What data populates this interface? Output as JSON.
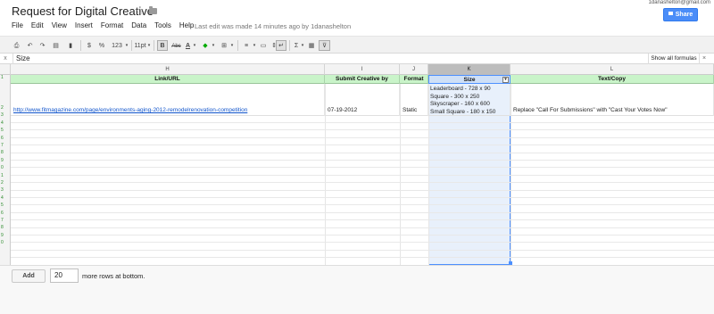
{
  "window": {
    "title": "Request for Digital Creative",
    "account_email": "1danashelton@gmail.com",
    "share_label": "Share"
  },
  "menu": [
    "File",
    "Edit",
    "View",
    "Insert",
    "Format",
    "Data",
    "Tools",
    "Help"
  ],
  "last_edit": "Last edit was made 14 minutes ago by 1danashelton",
  "toolbar": {
    "currency": "$",
    "percent": "%",
    "number_format": "123",
    "font_size": "11pt",
    "bold": "B",
    "strikethrough": "Abc",
    "text_color": "A",
    "sum": "Σ"
  },
  "formula_bar": {
    "fx": "x",
    "value": "Size",
    "show_all": "Show all formulas",
    "close": "×"
  },
  "columns": [
    "H",
    "I",
    "J",
    "K",
    "L"
  ],
  "selected_column": "K",
  "headers": [
    "Link/URL",
    "Submit Creative by",
    "Format",
    "Size",
    "Text/Copy"
  ],
  "row": {
    "link": "http://www.fitmagazine.com/page/environments-aging-2012-remodelrenovation-competition",
    "submit_by": "07-19-2012",
    "format": "Static",
    "sizes": [
      "Leaderboard - 728 x 90",
      "Square - 300 x 250",
      "Skyscraper - 160 x 600",
      "Small Square - 180 x 150"
    ],
    "text_copy": "Replace \"Call For Submissions\" with \"Cast Your Votes Now\""
  },
  "row_numbers": [
    "1",
    "2",
    "3",
    "4",
    "5",
    "6",
    "7",
    "8",
    "9",
    "0",
    "1",
    "2",
    "3",
    "4",
    "5",
    "6",
    "7",
    "8",
    "9",
    "0"
  ],
  "footer": {
    "add_label": "Add",
    "rows_value": "20",
    "rows_suffix": "more rows at bottom."
  }
}
